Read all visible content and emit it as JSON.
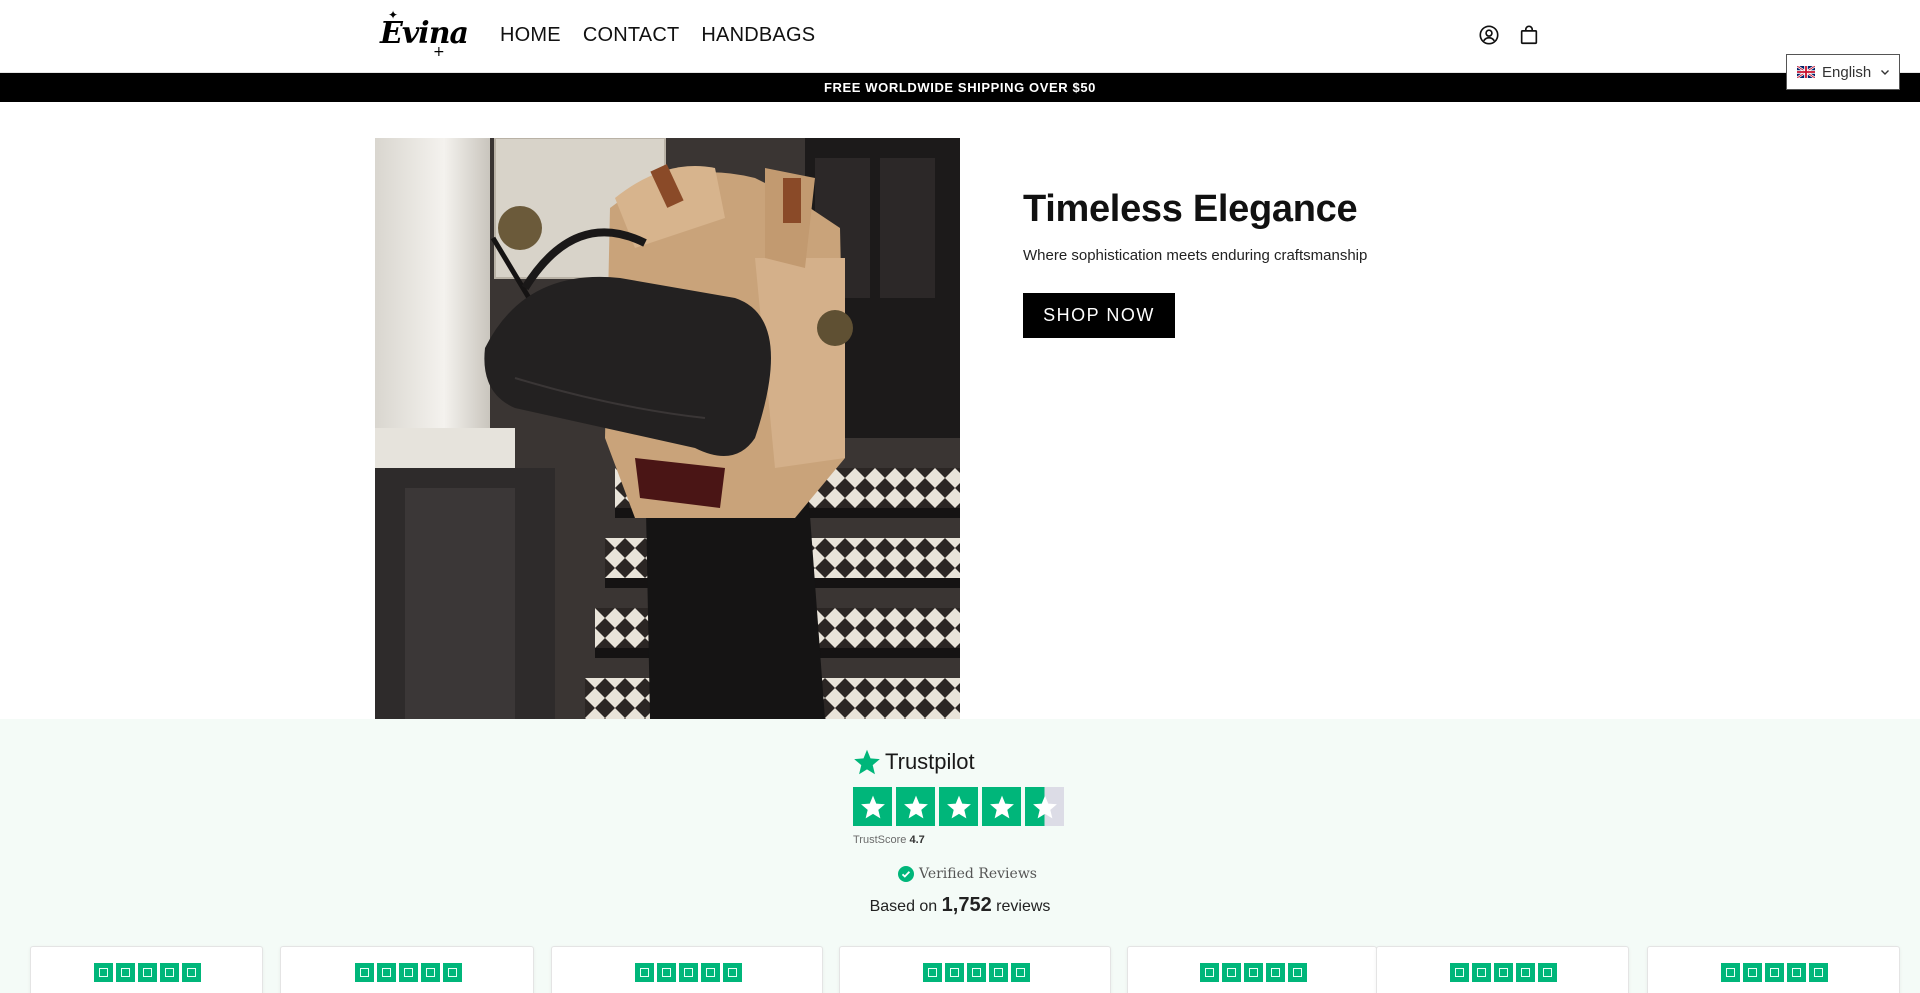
{
  "header": {
    "logo_text": "Evina",
    "nav": [
      {
        "label": "HOME"
      },
      {
        "label": "CONTACT"
      },
      {
        "label": "HANDBAGS"
      }
    ],
    "icons": [
      "account-icon",
      "cart-icon"
    ]
  },
  "language": {
    "label": "English",
    "flag_icon": "uk-flag-icon"
  },
  "announcement": {
    "text": "FREE WORLDWIDE SHIPPING OVER $50"
  },
  "hero": {
    "title": "Timeless Elegance",
    "subtitle": "Where sophistication meets enduring craftsmanship",
    "button_label": "SHOP NOW"
  },
  "trustpilot": {
    "brand": "Trustpilot",
    "score_label": "TrustScore",
    "score_value": "4.7",
    "stars": 4.5,
    "verified_label": "Verified Reviews",
    "based_prefix": "Based on",
    "review_count": "1,752",
    "based_suffix": "reviews",
    "accent_color": "#00b67a",
    "review_cards_visible": 7
  }
}
